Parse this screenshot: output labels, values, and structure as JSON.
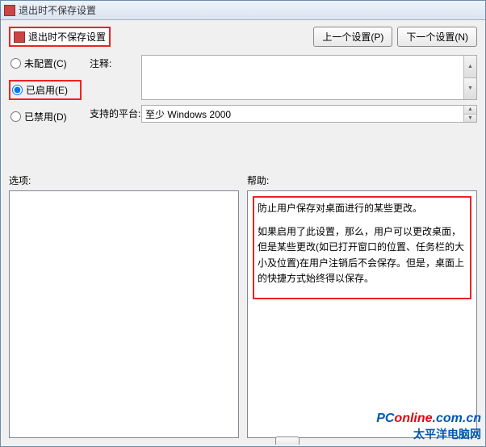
{
  "titlebar": {
    "title": "退出时不保存设置"
  },
  "header": {
    "setting_title": "退出时不保存设置",
    "prev_btn": "上一个设置(P)",
    "next_btn": "下一个设置(N)"
  },
  "radios": {
    "not_configured": "未配置(C)",
    "enabled": "已启用(E)",
    "disabled": "已禁用(D)",
    "selected": "enabled"
  },
  "fields": {
    "comment_label": "注释:",
    "platform_label": "支持的平台:",
    "platform_value": "至少 Windows 2000"
  },
  "lower": {
    "options_label": "选项:",
    "help_label": "帮助:",
    "help_paragraphs": [
      "防止用户保存对桌面进行的某些更改。",
      "如果启用了此设置，那么，用户可以更改桌面，但是某些更改(如已打开窗口的位置、任务栏的大小及位置)在用户注销后不会保存。但是，桌面上的快捷方式始终得以保存。"
    ]
  },
  "watermark": {
    "line1a": "PC",
    "line1b": "online",
    "line1c": ".com.cn",
    "line2": "太平洋电脑网"
  }
}
